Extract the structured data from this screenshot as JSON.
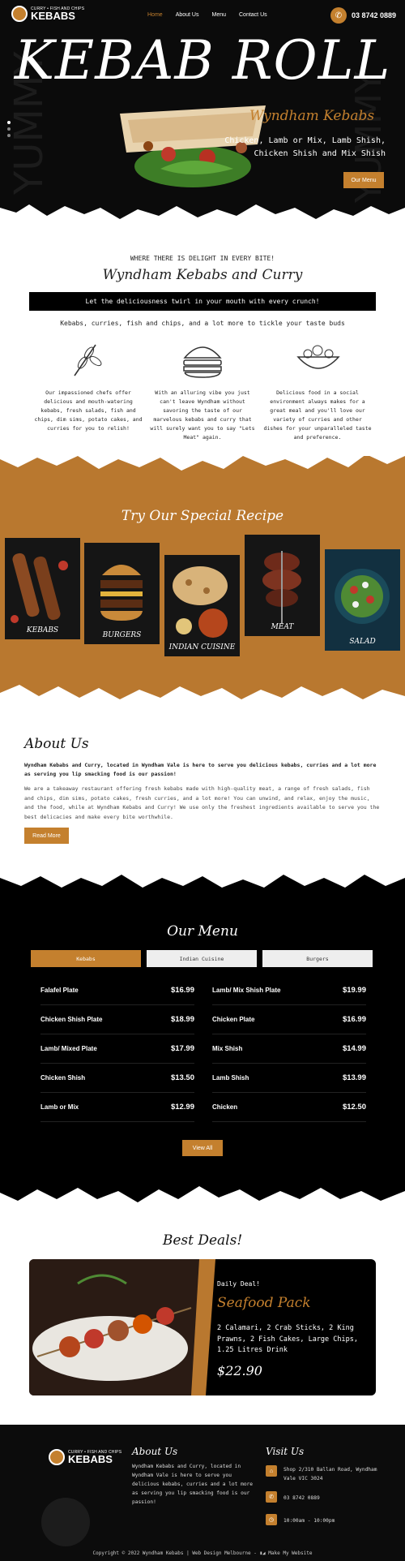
{
  "header": {
    "logo": {
      "top": "CURRY • FISH AND CHIPS",
      "main": "KEBABS"
    },
    "nav": [
      "Home",
      "About Us",
      "Menu",
      "Contact Us"
    ],
    "phone": "03 8742 0889",
    "hero_title": "KEBAB ROLL",
    "hero_subtitle": "Wyndham Kebabs",
    "hero_desc_1": "Chicken, Lamb or Mix, Lamb Shish,",
    "hero_desc_2": "Chicken Shish and Mix Shish",
    "hero_button": "Our Menu"
  },
  "intro": {
    "kicker": "WHERE THERE IS DELIGHT IN EVERY BITE!",
    "title": "Wyndham Kebabs and Curry",
    "bar": "Let the deliciousness twirl in your mouth with every crunch!",
    "line": "Kebabs, curries, fish and chips, and a lot more to tickle your taste buds",
    "features": [
      {
        "icon": "wheat-icon",
        "text": "Our impassioned chefs offer delicious and mouth-watering kebabs, fresh salads, fish and chips, dim sims, potato cakes, and curries for you to relish!"
      },
      {
        "icon": "burger-icon",
        "text": "With an alluring vibe you just can't leave Wyndham without savoring the taste of our marvelous kebabs and curry that will surely want you to say \"Lets Meat\" again."
      },
      {
        "icon": "salad-bowl-icon",
        "text": "Delicious food in a social environment always makes for a great meal and you'll love our variety of curries and other dishes for your unparalleled taste and preference."
      }
    ]
  },
  "special": {
    "title": "Try Our Special Recipe",
    "cards": [
      "KEBABS",
      "BURGERS",
      "INDIAN CUISINE",
      "MEAT",
      "SALAD"
    ]
  },
  "about": {
    "title": "About Us",
    "bold": "Wyndham Kebabs and Curry, located in Wyndham Vale is here to serve you delicious kebabs, curries and a lot more as serving you lip smacking food is our passion!",
    "body": "We are a takeaway restaurant offering fresh kebabs made with high-quality meat, a range of fresh salads, fish and chips, dim sims, potato cakes, fresh curries, and a lot more! You can unwind, and relax, enjoy the music, and the food, while at Wyndham Kebabs and Curry! We use only the freshest ingredients available to serve you the best delicacies and make every bite worthwhile.",
    "button": "Read More"
  },
  "menu": {
    "title": "Our Menu",
    "tabs": [
      "Kebabs",
      "Indian Cuisine",
      "Burgers"
    ],
    "left": [
      {
        "name": "Falafel Plate",
        "price": "$16.99"
      },
      {
        "name": "Chicken Shish Plate",
        "price": "$18.99"
      },
      {
        "name": "Lamb/ Mixed Plate",
        "price": "$17.99"
      },
      {
        "name": "Chicken Shish",
        "price": "$13.50"
      },
      {
        "name": "Lamb or Mix",
        "price": "$12.99"
      }
    ],
    "right": [
      {
        "name": "Lamb/ Mix Shish Plate",
        "price": "$19.99"
      },
      {
        "name": "Chicken Plate",
        "price": "$16.99"
      },
      {
        "name": "Mix Shish",
        "price": "$14.99"
      },
      {
        "name": "Lamb Shish",
        "price": "$13.99"
      },
      {
        "name": "Chicken",
        "price": "$12.50"
      }
    ],
    "button": "View All"
  },
  "deals": {
    "title": "Best Deals!",
    "kicker": "Daily Deal!",
    "name": "Seafood Pack",
    "desc": "2 Calamari, 2 Crab Sticks, 2 King Prawns, 2 Fish Cakes, Large Chips, 1.25 Litres Drink",
    "price": "$22.90"
  },
  "footer": {
    "about_title": "About Us",
    "about_text": "Wyndham Kebabs and Curry, located in Wyndham Vale is here to serve you delicious kebabs, curries and a lot more as serving you lip smacking food is our passion!",
    "visit_title": "Visit Us",
    "address": "Shop 2/310 Ballan Road, Wyndham Vale VIC 3024",
    "phone": "03 8742 0889",
    "hours": "10:00am - 10:00pm",
    "copyright": "Copyright © 2022 Wyndham Kebabs | Web Design Melbourne -",
    "credit": "Make My Website"
  },
  "colors": {
    "accent": "#c4802e",
    "dark": "#0b0b0b"
  }
}
